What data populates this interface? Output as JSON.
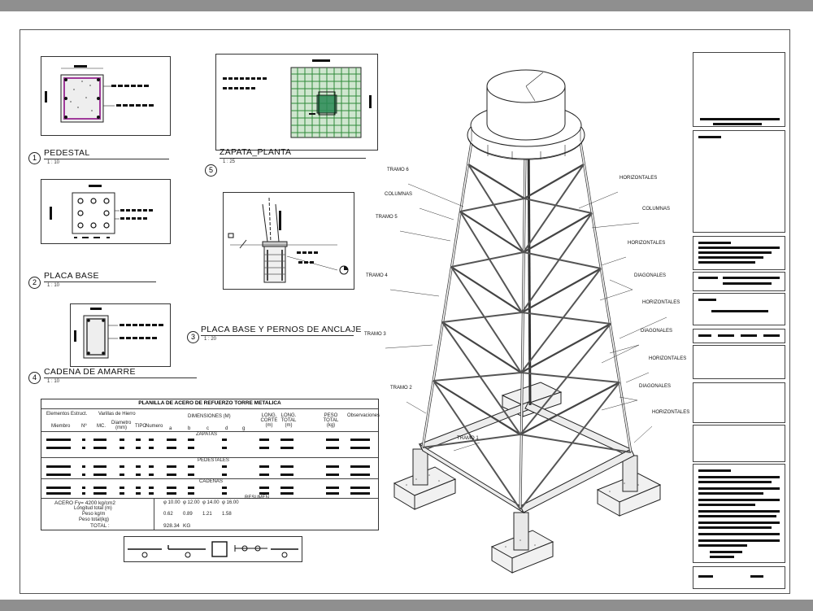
{
  "details": [
    {
      "number": "1",
      "title": "PEDESTAL",
      "scale": "1 : 10"
    },
    {
      "number": "2",
      "title": "PLACA BASE",
      "scale": "1 : 10"
    },
    {
      "number": "3",
      "title": "PLACA BASE Y PERNOS DE ANCLAJE",
      "scale": "1 : 20"
    },
    {
      "number": "4",
      "title": "CADENA DE AMARRE",
      "scale": "1 : 10"
    },
    {
      "number": "5",
      "title": "ZAPATA_PLANTA",
      "scale": "1 : 25"
    }
  ],
  "tower_labels": {
    "tramo6": "TRAMO 6",
    "tramo5": "TRAMO 5",
    "tramo4": "TRAMO 4",
    "tramo3": "TRAMO 3",
    "tramo2": "TRAMO 2",
    "tramo1": "TRAMO 1",
    "columnas_left": "COLUMNAS",
    "columnas_right": "COLUMNAS",
    "horizontales1": "HORIZONTALES",
    "horizontales2": "HORIZONTALES",
    "horizontales3": "HORIZONTALES",
    "horizontales4": "HORIZONTALES",
    "horizontales5": "HORIZONTALES",
    "diagonales1": "DIAGONALES",
    "diagonales2": "DIAGONALES",
    "diagonales3": "DIAGONALES"
  },
  "schedule": {
    "title": "PLANILLA DE ACERO DE REFUERZO TORRE METALICA",
    "h_elementos": "Elementos Estruct.",
    "h_varillas": "Varillas de Hierro",
    "h_dimensiones": "DIMENSIONES (M)",
    "h_long_corte": "LONG. CORTE (m)",
    "h_long_total": "LONG. TOTAL (m)",
    "h_peso": "PESO TOTAL (kg)",
    "h_obs": "Observaciones",
    "h_miembro": "Miembro",
    "h_n": "Nº",
    "h_mc": "MC.",
    "h_diam": "Diametro (mm)",
    "h_tipo": "TIPO",
    "h_numero": "Numero",
    "cols": [
      "a",
      "b",
      "c",
      "d",
      "g"
    ],
    "sec_zapatas": "ZAPATAS",
    "sec_pedestales": "PEDESTALES",
    "sec_cadenas": "CADENAS",
    "acero": "ACERO Fy= 4200 kg/cm2",
    "resumen": "RESUMEN",
    "diam_row": [
      "φ 10.00",
      "φ 12.00",
      "φ 14.00",
      "φ 16.00"
    ],
    "row_long": "Longitud total (m)",
    "row_peso": "Peso kg/m",
    "row_total_kg": "Peso total(kg)",
    "peso_vals": [
      "0.62",
      "0.89",
      "1.21",
      "1.58"
    ],
    "total_label": "TOTAL :",
    "total_value": "928.34",
    "total_unit": "KG"
  }
}
